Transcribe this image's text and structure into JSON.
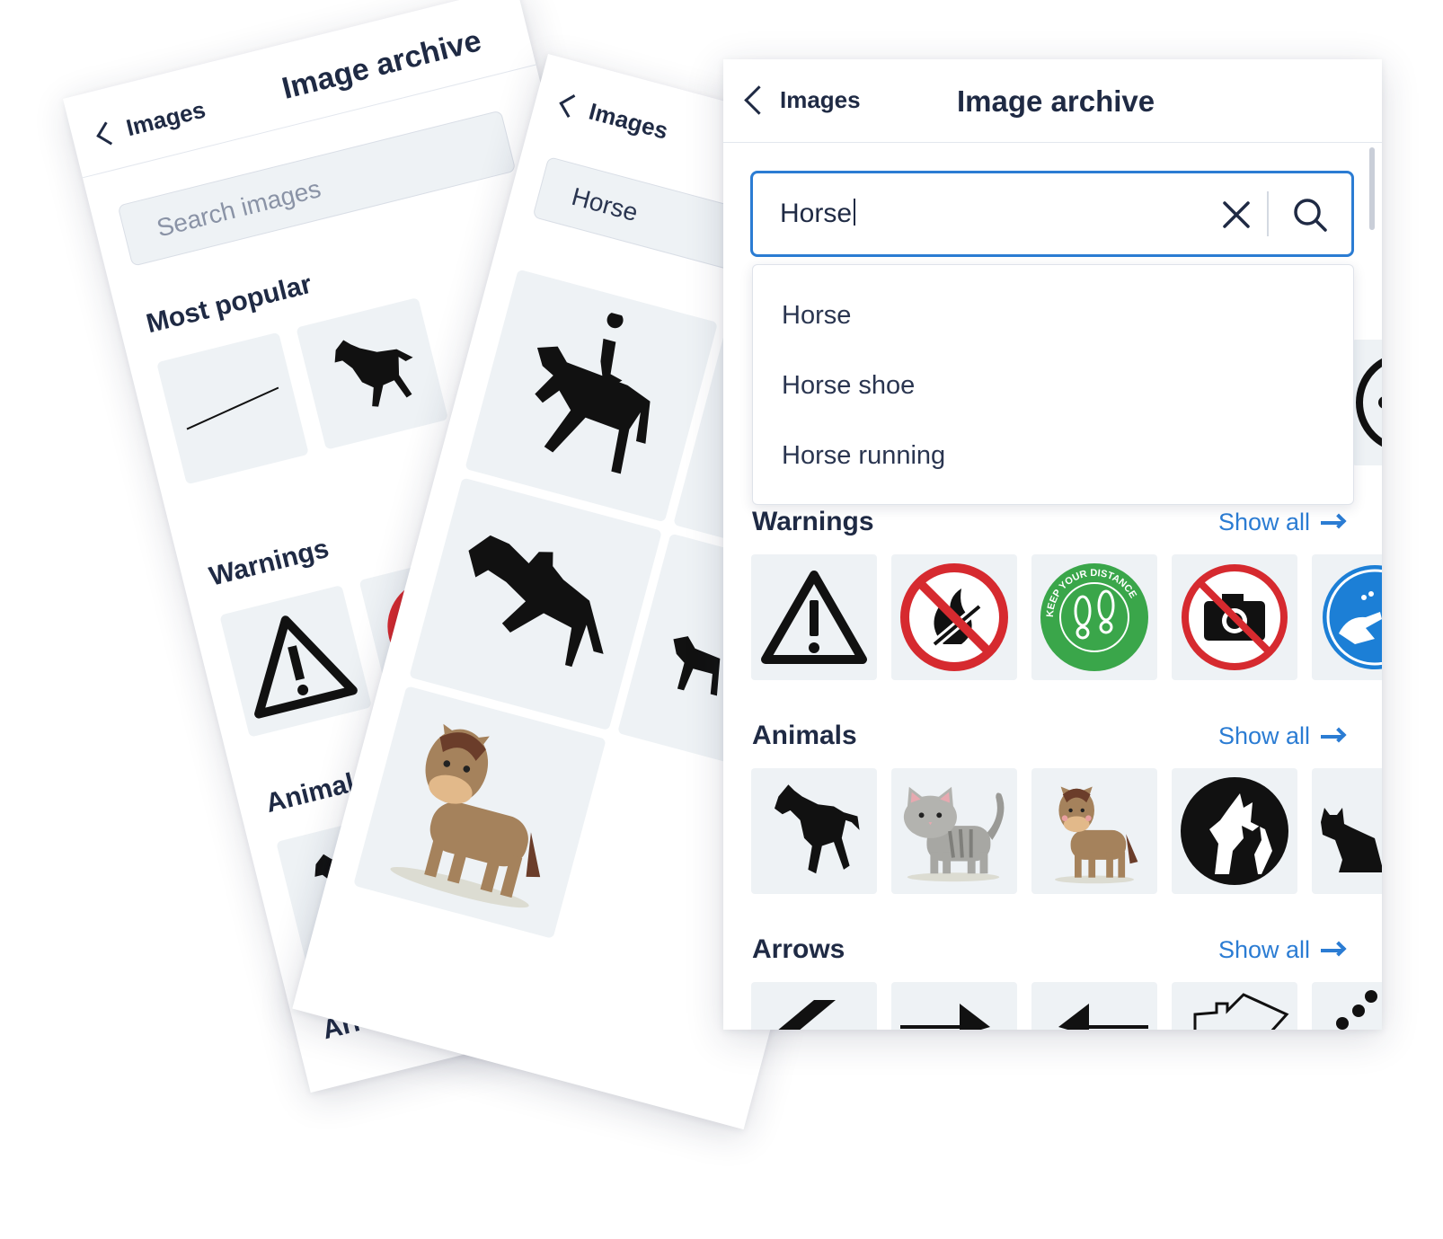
{
  "back_card_1": {
    "back_label": "Images",
    "title": "Image archive",
    "search_placeholder": "Search images",
    "sections": [
      "Most popular",
      "Warnings",
      "Animals",
      "Arrows"
    ]
  },
  "back_card_2": {
    "back_label": "Images",
    "search_value": "Horse"
  },
  "front": {
    "back_label": "Images",
    "title": "Image archive",
    "search_value": "Horse",
    "suggestions": [
      "Horse",
      "Horse shoe",
      "Horse running"
    ],
    "show_all_label": "Show all",
    "sections": [
      {
        "title": "Warnings",
        "icons": [
          "warning-triangle-icon",
          "no-fire-icon",
          "keep-your-distance-icon",
          "no-camera-icon",
          "wash-hands-icon"
        ]
      },
      {
        "title": "Animals",
        "icons": [
          "running-horse-icon",
          "cat-icon",
          "cartoon-horse-icon",
          "dog-and-cat-icon",
          "sitting-cat-icon"
        ]
      },
      {
        "title": "Arrows",
        "icons": [
          "diagonal-arrow-icon",
          "right-arrow-icon",
          "left-arrow-icon",
          "outline-arrow-icon",
          "dotted-curve-icon"
        ]
      }
    ],
    "badge_text": "KEEP YOUR DISTANCE"
  },
  "colors": {
    "accent": "#2b7cd3",
    "text": "#1f2a44",
    "tile_bg": "#eef2f5",
    "danger": "#d62a2f",
    "green": "#3aa64a"
  }
}
